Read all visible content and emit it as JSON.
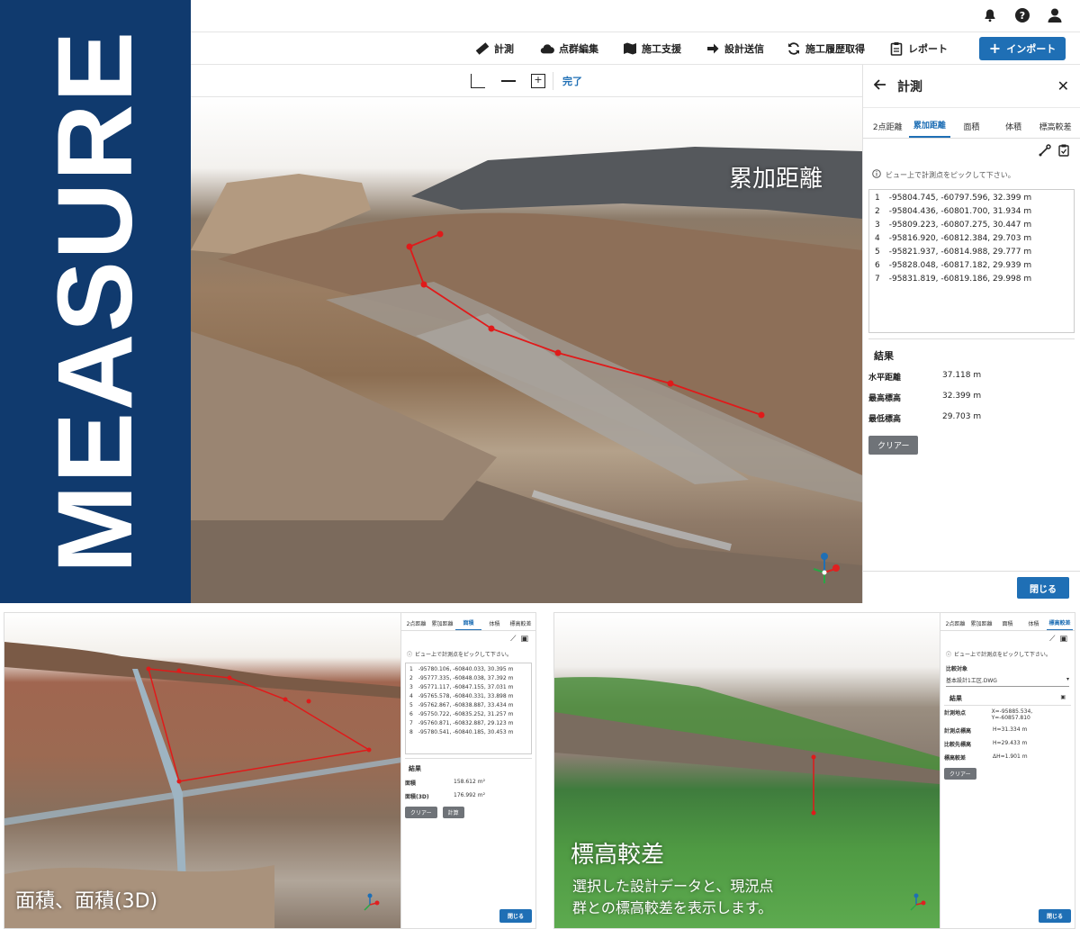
{
  "brand": {
    "title": "MEASURE"
  },
  "header": {
    "bell_icon": "bell-icon",
    "help_icon": "help-icon",
    "user_icon": "user-icon"
  },
  "toolbar": {
    "items": [
      {
        "label": "計測",
        "icon": "ruler-icon"
      },
      {
        "label": "点群編集",
        "icon": "cloud-icon"
      },
      {
        "label": "施工支援",
        "icon": "map-icon"
      },
      {
        "label": "設計送信",
        "icon": "arrow-right-icon"
      },
      {
        "label": "施工履歴取得",
        "icon": "sync-icon"
      },
      {
        "label": "レポート",
        "icon": "clipboard-icon"
      }
    ],
    "import_label": "インポート"
  },
  "subbar": {
    "done_label": "完了"
  },
  "viewport": {
    "overlay_title": "累加距離"
  },
  "panel": {
    "title": "計測",
    "tabs": [
      "2点距離",
      "累加距離",
      "面積",
      "体積",
      "標高較差"
    ],
    "active_tab": 1,
    "hint": "ビュー上で計測点をピックして下さい。",
    "points": [
      {
        "no": "1",
        "coord": "-95804.745, -60797.596, 32.399 m"
      },
      {
        "no": "2",
        "coord": "-95804.436, -60801.700, 31.934 m"
      },
      {
        "no": "3",
        "coord": "-95809.223, -60807.275, 30.447 m"
      },
      {
        "no": "4",
        "coord": "-95816.920, -60812.384, 29.703 m"
      },
      {
        "no": "5",
        "coord": "-95821.937, -60814.988, 29.777 m"
      },
      {
        "no": "6",
        "coord": "-95828.048, -60817.182, 29.939 m"
      },
      {
        "no": "7",
        "coord": "-95831.819, -60819.186, 29.998 m"
      }
    ],
    "result_title": "結果",
    "results": [
      {
        "label": "水平距離",
        "value": "37.118 m"
      },
      {
        "label": "最高標高",
        "value": "32.399 m"
      },
      {
        "label": "最低標高",
        "value": "29.703 m"
      }
    ],
    "clear_label": "クリアー",
    "close_label": "閉じる"
  },
  "shot_area": {
    "caption": "面積、面積(3D)",
    "tabs": [
      "2点距離",
      "累加距離",
      "面積",
      "体積",
      "標高較差"
    ],
    "active_tab": 2,
    "hint": "ビュー上で計測点をピックして下さい。",
    "points": [
      {
        "no": "1",
        "coord": "-95780.106, -60840.033, 30.395 m"
      },
      {
        "no": "2",
        "coord": "-95777.335, -60848.038, 37.392 m"
      },
      {
        "no": "3",
        "coord": "-95771.117, -60847.155, 37.031 m"
      },
      {
        "no": "4",
        "coord": "-95765.578, -60840.331, 33.898 m"
      },
      {
        "no": "5",
        "coord": "-95762.867, -60838.887, 33.434 m"
      },
      {
        "no": "6",
        "coord": "-95750.722, -60835.252, 31.257 m"
      },
      {
        "no": "7",
        "coord": "-95760.871, -60832.887, 29.123 m"
      },
      {
        "no": "8",
        "coord": "-95780.541, -60840.185, 30.453 m"
      }
    ],
    "result_title": "結果",
    "results": [
      {
        "label": "面積",
        "value": "158.612 m²"
      },
      {
        "label": "面積(3D)",
        "value": "176.992 m²"
      }
    ],
    "clear_label": "クリアー",
    "calc_label": "計算",
    "close_label": "閉じる"
  },
  "shot_elev": {
    "title": "標高較差",
    "desc_line1": "選択した設計データと、現況点",
    "desc_line2": "群との標高較差を表示します。",
    "tabs": [
      "2点距離",
      "累加距離",
      "面積",
      "体積",
      "標高較差"
    ],
    "active_tab": 4,
    "hint": "ビュー上で計測点をピックして下さい。",
    "compare_label": "比較対象",
    "compare_value": "基本設計1工区.DWG",
    "result_title": "結果",
    "results": [
      {
        "label": "計測地点",
        "value": "X=-95885.534, Y=-60857.810"
      },
      {
        "label": "計測点標高",
        "value": "H=31.334 m"
      },
      {
        "label": "比較先標高",
        "value": "H=29.433 m"
      },
      {
        "label": "標高較差",
        "value": "ΔH=1.901 m"
      }
    ],
    "clear_label": "クリアー",
    "close_label": "閉じる"
  }
}
